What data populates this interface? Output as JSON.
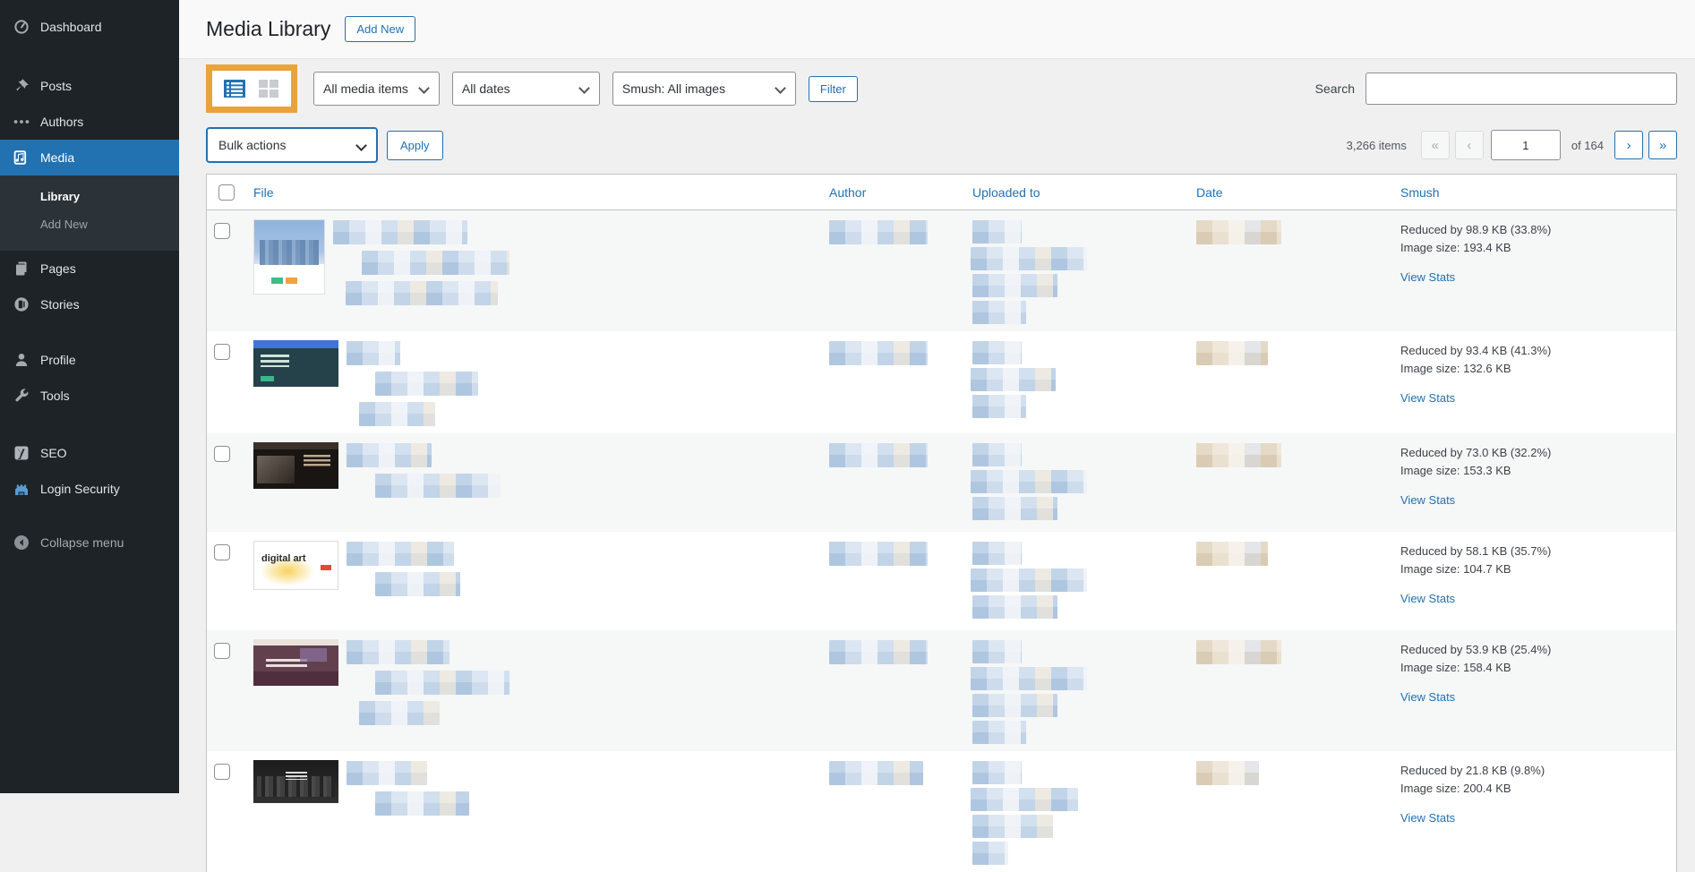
{
  "sidebar": {
    "items": [
      {
        "id": "dashboard",
        "label": "Dashboard",
        "icon": "dashboard-icon",
        "active": false
      },
      {
        "id": "posts",
        "label": "Posts",
        "icon": "pushpin-icon",
        "active": false
      },
      {
        "id": "authors",
        "label": "Authors",
        "icon": "ellipsis-icon",
        "active": false
      },
      {
        "id": "media",
        "label": "Media",
        "icon": "media-icon",
        "active": true
      },
      {
        "id": "pages",
        "label": "Pages",
        "icon": "pages-icon",
        "active": false
      },
      {
        "id": "stories",
        "label": "Stories",
        "icon": "stories-icon",
        "active": false
      },
      {
        "id": "profile",
        "label": "Profile",
        "icon": "user-icon",
        "active": false
      },
      {
        "id": "tools",
        "label": "Tools",
        "icon": "wrench-icon",
        "active": false
      },
      {
        "id": "seo",
        "label": "SEO",
        "icon": "yoast-icon",
        "active": false
      },
      {
        "id": "login-security",
        "label": "Login Security",
        "icon": "fortress-icon",
        "active": false
      },
      {
        "id": "collapse",
        "label": "Collapse menu",
        "icon": "collapse-icon",
        "active": false
      }
    ],
    "media_submenu": [
      {
        "label": "Library",
        "current": true
      },
      {
        "label": "Add New",
        "current": false
      }
    ]
  },
  "header": {
    "title": "Media Library",
    "add_new": "Add New"
  },
  "filters": {
    "media_type": "All media items",
    "date": "All dates",
    "smush": "Smush: All images",
    "filter_button": "Filter",
    "search_label": "Search",
    "search_value": ""
  },
  "bulk_actions": {
    "select_value": "Bulk actions",
    "apply": "Apply"
  },
  "pagination": {
    "total": "3,266 items",
    "first": "«",
    "prev": "‹",
    "page": "1",
    "of": "of 164",
    "next": "›",
    "last": "»"
  },
  "table": {
    "columns": [
      "File",
      "Author",
      "Uploaded to",
      "Date",
      "Smush"
    ],
    "rows": [
      {
        "smush_reduced": "Reduced by 98.9 KB (33.8%)",
        "smush_size": "Image size: 193.4 KB",
        "view_stats": "View Stats",
        "thumb": {
          "variant": "cityscape-day",
          "text": ""
        },
        "redacted": {
          "file_lines": [
            150,
            165,
            170
          ],
          "author": 110,
          "uploaded_lines": [
            55,
            130,
            95,
            60
          ],
          "date": 95
        }
      },
      {
        "smush_reduced": "Reduced by 93.4 KB (41.3%)",
        "smush_size": "Image size: 132.6 KB",
        "view_stats": "View Stats",
        "thumb": {
          "variant": "watch-hero",
          "text": ""
        },
        "redacted": {
          "file_lines": [
            60,
            115,
            85
          ],
          "author": 110,
          "uploaded_lines": [
            55,
            95,
            60
          ],
          "date": 80
        }
      },
      {
        "smush_reduced": "Reduced by 73.0 KB (32.2%)",
        "smush_size": "Image size: 153.3 KB",
        "view_stats": "View Stats",
        "thumb": {
          "variant": "dark-workspace",
          "text": ""
        },
        "redacted": {
          "file_lines": [
            95,
            140
          ],
          "author": 110,
          "uploaded_lines": [
            55,
            130,
            95
          ],
          "date": 95
        }
      },
      {
        "smush_reduced": "Reduced by 58.1 KB (35.7%)",
        "smush_size": "Image size: 104.7 KB",
        "view_stats": "View Stats",
        "thumb": {
          "variant": "digital-art",
          "text": "digital art"
        },
        "redacted": {
          "file_lines": [
            120,
            95
          ],
          "author": 110,
          "uploaded_lines": [
            55,
            130,
            95
          ],
          "date": 80
        }
      },
      {
        "smush_reduced": "Reduced by 53.9 KB (25.4%)",
        "smush_size": "Image size: 158.4 KB",
        "view_stats": "View Stats",
        "thumb": {
          "variant": "maroon-hero",
          "text": ""
        },
        "redacted": {
          "file_lines": [
            115,
            150,
            90
          ],
          "author": 110,
          "uploaded_lines": [
            55,
            130,
            95,
            60
          ],
          "date": 95
        }
      },
      {
        "smush_reduced": "Reduced by 21.8 KB (9.8%)",
        "smush_size": "Image size: 200.4 KB",
        "view_stats": "View Stats",
        "thumb": {
          "variant": "night-skyline",
          "text": ""
        },
        "redacted": {
          "file_lines": [
            90,
            105
          ],
          "author": 105,
          "uploaded_lines": [
            55,
            120,
            90,
            40
          ],
          "date": 70
        }
      }
    ]
  },
  "annotation": {
    "highlight_color": "#e8a33d"
  },
  "colors": {
    "accent": "#2271b1",
    "sidebar_bg": "#1d2327",
    "active_bg": "#2271b1",
    "row_alt": "#f6f7f7"
  }
}
